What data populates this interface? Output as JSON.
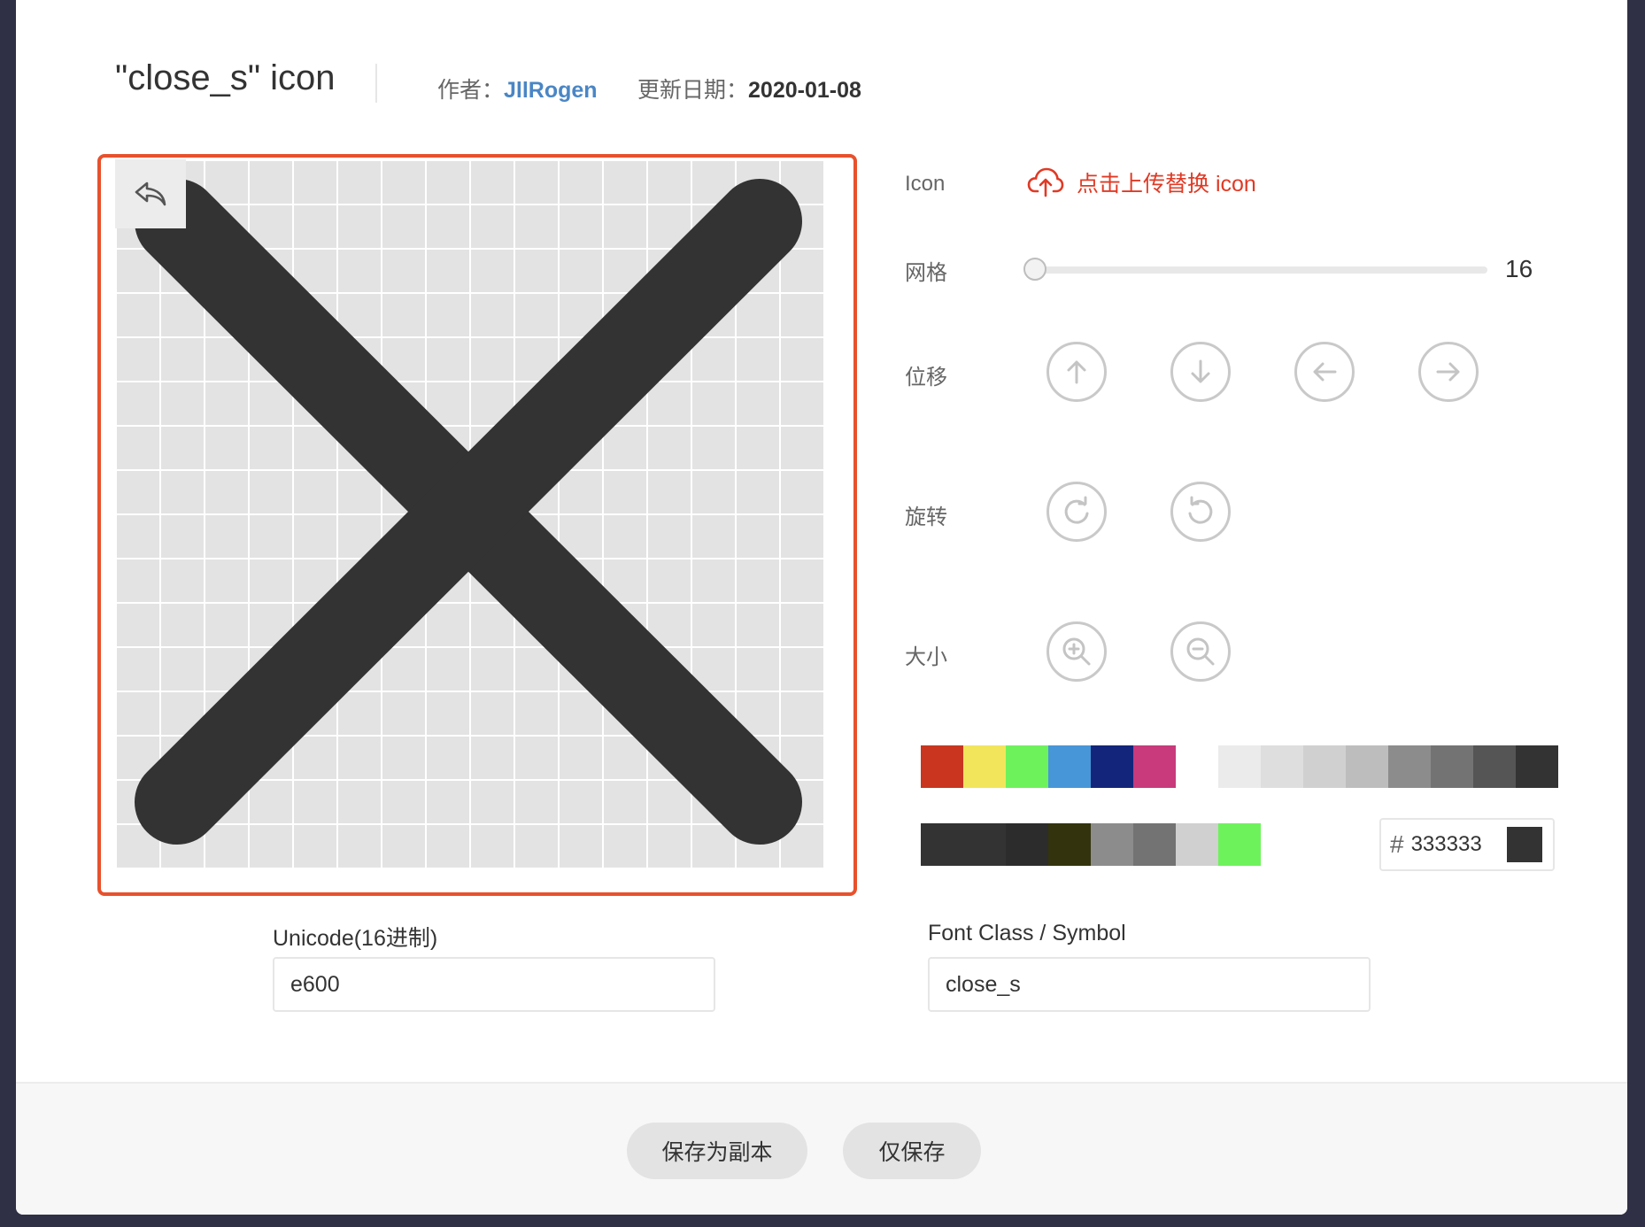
{
  "header": {
    "title": "\"close_s\"  icon",
    "author_label": "作者：",
    "author_name": "JllRogen",
    "date_label": "更新日期：",
    "date_value": "2020-01-08"
  },
  "editor": {
    "icon_color": "#333333",
    "grid_color": "#e3e3e3",
    "frame_color": "#e8512c"
  },
  "controls": {
    "icon_label": "Icon",
    "upload_label": "点击上传替换 icon",
    "grid_label": "网格",
    "grid_value": "16",
    "move_label": "位移",
    "rotate_label": "旋转",
    "size_label": "大小"
  },
  "palette": {
    "row1": [
      "#c9351f",
      "#f2e55c",
      "#6ef25c",
      "#4796d8",
      "#13257a",
      "#c83a7b",
      "#ffffff",
      "#ebebeb",
      "#dedede",
      "#d0d0d0",
      "#bdbdbd",
      "#8c8c8c",
      "#737373",
      "#555555",
      "#333333"
    ],
    "row2": [
      "#333333",
      "#333333",
      "#2c2c2c",
      "#33330d",
      "#8c8c8c",
      "#737373",
      "#d0d0d0",
      "#6ef25c"
    ],
    "hash": "#",
    "hex_value": "333333",
    "preview_color": "#333333"
  },
  "fields": {
    "unicode_label": "Unicode(16进制)",
    "unicode_value": "e600",
    "fontclass_label": "Font Class / Symbol",
    "fontclass_value": "close_s"
  },
  "footer": {
    "save_copy": "保存为副本",
    "save_only": "仅保存"
  }
}
